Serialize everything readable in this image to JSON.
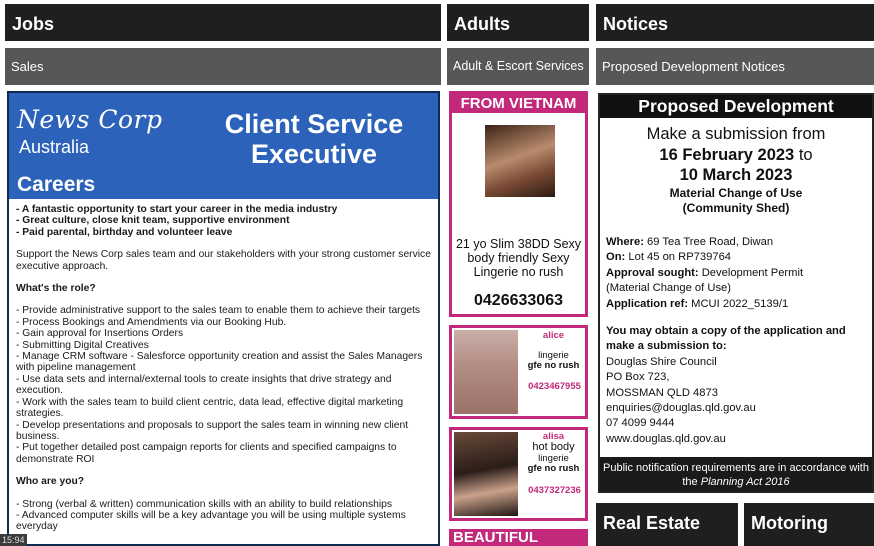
{
  "jobs": {
    "header": "Jobs",
    "subheader": "Sales",
    "ad": {
      "brand": "News Corp",
      "brand_region": "Australia",
      "careers": "Careers",
      "title": "Client Service Executive",
      "highlights": [
        "- A fantastic opportunity to start your career in the media industry",
        "- Great culture, close knit team, supportive environment",
        "- Paid parental, birthday and volunteer leave"
      ],
      "intro": "Support the News Corp sales team and our stakeholders with your  strong customer service executive approach.",
      "role_heading": "What's the role?",
      "role_items": [
        "- Provide administrative support to the sales team to enable them to achieve their targets",
        "- Process Bookings and Amendments via our Booking Hub.",
        "- Gain approval for Insertions Orders",
        "- Submitting Digital Creatives",
        "- Manage CRM software - Salesforce opportunity creation and assist the Sales Managers with pipeline management",
        "- Use data sets and internal/external tools to create insights that drive strategy and execution.",
        "- Work with the sales team to build client centric,  data lead, effective digital marketing strategies.",
        "- Develop presentations and proposals to support the sales team in winning new client business.",
        "- Put together detailed post campaign reports for clients and specified campaigns to demonstrate ROI"
      ],
      "who_heading": "Who are you?",
      "who_items": [
        "- Strong (verbal & written) communication skills with an ability to build relationships",
        "- Advanced computer skills will be a key advantage you will be using multiple systems everyday"
      ]
    },
    "timestamp": "15:94"
  },
  "adults": {
    "header": "Adults",
    "subheader": "Adult & Escort Services",
    "ad1": {
      "headline": "FROM VIETNAM",
      "text": "21 yo Slim 38DD Sexy body friendly Sexy Lingerie no rush",
      "phone": "0426633063"
    },
    "ad2": {
      "name": "alice",
      "desc1": "lingerie",
      "desc2": "gfe no rush",
      "phone": "0423467955"
    },
    "ad3": {
      "name": "alisa",
      "desc1": "hot body",
      "desc2": "lingerie",
      "desc3": "gfe no rush",
      "phone": "0437327236"
    },
    "ad4": {
      "headline": "BEAUTIFUL"
    }
  },
  "notices": {
    "header": "Notices",
    "subheader": "Proposed Development Notices",
    "ad": {
      "title": "Proposed Development",
      "intro": "Make a submission from",
      "date_from": "16 February 2023",
      "to": "to",
      "date_to": "10 March 2023",
      "type_line1": "Material Change of Use",
      "type_line2": "(Community Shed)",
      "where_label": "Where:",
      "where": "69 Tea Tree Road, Diwan",
      "on_label": "On:",
      "on": "Lot 45 on RP739764",
      "approval_label": "Approval sought:",
      "approval": "Development Permit",
      "approval_detail": "(Material Change of Use)",
      "ref_label": "Application ref:",
      "ref": "MCUI 2022_5139/1",
      "obtain": "You may obtain a copy of the application and make a submission to:",
      "council": "Douglas Shire Council",
      "po_box": "PO Box 723,",
      "town": "MOSSMAN QLD 4873",
      "email": "enquiries@douglas.qld.gov.au",
      "phone": "07 4099 9444",
      "website": "www.douglas.qld.gov.au",
      "footer": "Public notification requirements are in accordance with the",
      "footer_act": "Planning Act 2016"
    }
  },
  "real_estate": {
    "header": "Real Estate"
  },
  "motoring": {
    "header": "Motoring"
  }
}
